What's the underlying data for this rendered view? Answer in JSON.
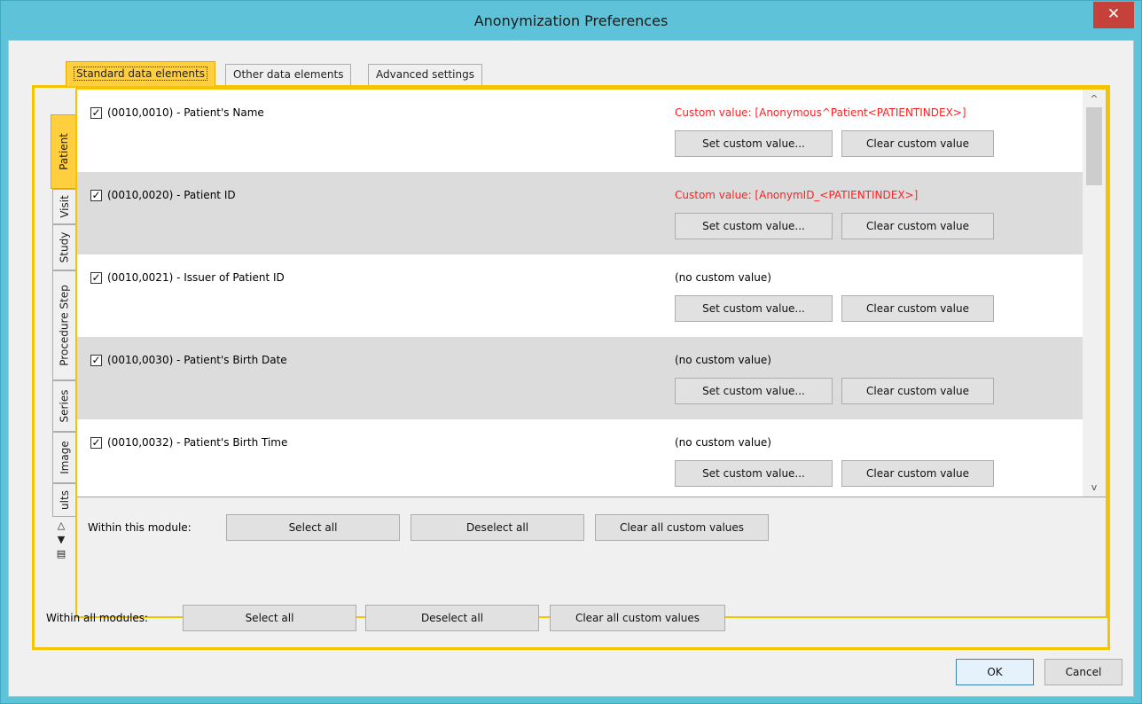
{
  "window": {
    "title": "Anonymization Preferences",
    "close_glyph": "✕"
  },
  "tabs": [
    {
      "label": "Standard data elements",
      "active": true
    },
    {
      "label": "Other data elements",
      "active": false
    },
    {
      "label": "Advanced settings",
      "active": false
    }
  ],
  "side_tabs": [
    {
      "label": "Patient",
      "active": true
    },
    {
      "label": "Visit",
      "active": false
    },
    {
      "label": "Study",
      "active": false
    },
    {
      "label": "Procedure Step",
      "active": false
    },
    {
      "label": "Series",
      "active": false
    },
    {
      "label": "Image",
      "active": false
    },
    {
      "label": "ults",
      "active": false
    }
  ],
  "side_nav": {
    "up_glyph": "△",
    "down_glyph": "▼",
    "list_glyph": "▤"
  },
  "elements": [
    {
      "checked": true,
      "label": "(0010,0010) - Patient's Name",
      "custom_value": "Custom value: [Anonymous^Patient<PATIENTINDEX>]",
      "has_custom": true
    },
    {
      "checked": true,
      "label": "(0010,0020) - Patient ID",
      "custom_value": "Custom value: [AnonymID_<PATIENTINDEX>]",
      "has_custom": true
    },
    {
      "checked": true,
      "label": "(0010,0021) - Issuer of Patient ID",
      "custom_value": "(no custom value)",
      "has_custom": false
    },
    {
      "checked": true,
      "label": "(0010,0030) - Patient's Birth Date",
      "custom_value": "(no custom value)",
      "has_custom": false
    },
    {
      "checked": true,
      "label": "(0010,0032) - Patient's Birth Time",
      "custom_value": "(no custom value)",
      "has_custom": false
    }
  ],
  "row_buttons": {
    "set": "Set custom value...",
    "clear": "Clear custom value"
  },
  "module_actions": {
    "label": "Within this module:",
    "select_all": "Select all",
    "deselect_all": "Deselect all",
    "clear_all": "Clear all custom values"
  },
  "all_actions": {
    "label": "Within all modules:",
    "select_all": "Select all",
    "deselect_all": "Deselect all",
    "clear_all": "Clear all custom values"
  },
  "footer": {
    "ok": "OK",
    "cancel": "Cancel"
  },
  "colors": {
    "accent": "#f5c400",
    "titlebar": "#5ec3d9",
    "custom_value": "#ff2020",
    "close": "#c7413b"
  },
  "scrollbar": {
    "up_glyph": "^",
    "down_glyph": "v"
  }
}
